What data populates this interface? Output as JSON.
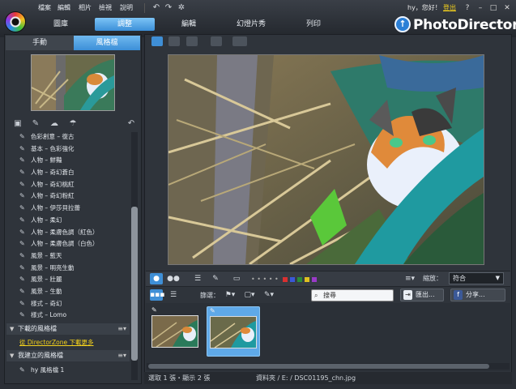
{
  "menu": [
    "檔案",
    "編輯",
    "相片",
    "檢視",
    "說明"
  ],
  "mode_tabs": [
    "圖庫",
    "調整",
    "編輯",
    "幻燈片秀",
    "列印"
  ],
  "user": {
    "greeting": "hy，您好！",
    "logout": "登出"
  },
  "window_buttons": [
    "?",
    "–",
    "□",
    "✕"
  ],
  "brand": "PhotoDirector",
  "left_tabs": {
    "manual": "手動",
    "style": "風格檔"
  },
  "presets": [
    "色彩創意 – 復古",
    "基本 – 色彩強化",
    "人物 – 鮮豔",
    "人物 – 奇幻蒼白",
    "人物 – 奇幻桃紅",
    "人物 – 奇幻粉紅",
    "人物 – 伊莎貝拉蕾",
    "人物 – 柔幻",
    "人物 – 柔膚色調（紅色）",
    "人物 – 柔膚色調（白色）",
    "風景 – 藍天",
    "風景 – 明亮生動",
    "風景 – 壯麗",
    "風景 – 生動",
    "樣式 – 奇幻",
    "樣式 – Lomo"
  ],
  "sections": {
    "downloaded": "下載的風格檔",
    "directorzone_link": "從 DirectorZone 下載更多",
    "my_styles": "我建立的風格檔",
    "my_style_item": "hy 風格檔 1"
  },
  "toolbar": {
    "zoom_label": "縮放：",
    "zoom_value": "符合"
  },
  "filter": {
    "label": "篩選：",
    "search_placeholder": "搜尋",
    "export": "匯出...",
    "share": "分享..."
  },
  "status": {
    "selection": "選取 1 張・顯示 2 張",
    "path": "資料夾 / E: / DSC01195_chn.jpg"
  },
  "colors": {
    "accent": "#3f8fd6",
    "link": "#f5d21c",
    "swatches": [
      "#d93030",
      "#3a58d8",
      "#2a8c3a",
      "#e0c020",
      "#9a3ac8"
    ]
  }
}
